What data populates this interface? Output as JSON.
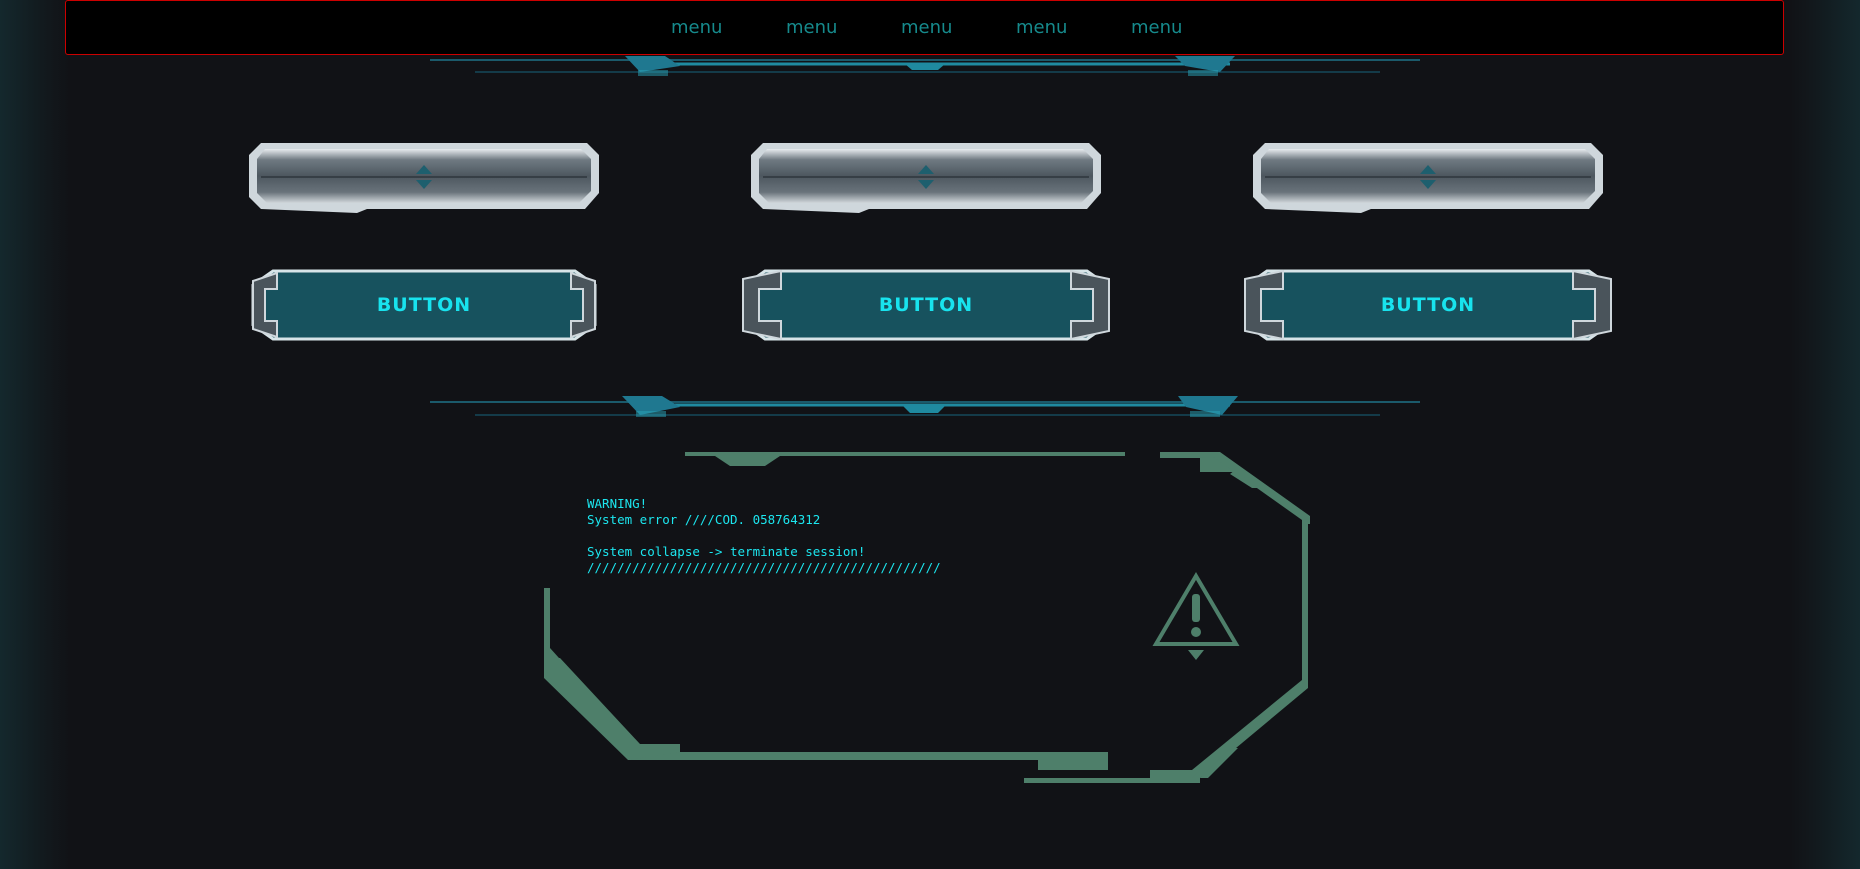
{
  "nav": {
    "items": [
      "menu",
      "menu",
      "menu",
      "menu",
      "menu"
    ]
  },
  "slots": [
    {
      "icon": "up-down-arrows-icon"
    },
    {
      "icon": "up-down-arrows-icon"
    },
    {
      "icon": "up-down-arrows-icon"
    }
  ],
  "buttons": [
    {
      "label": "BUTTON"
    },
    {
      "label": "BUTTON"
    },
    {
      "label": "BUTTON"
    }
  ],
  "warning": {
    "line1": "WARNING!",
    "line2": "System error ////COD. 058764312",
    "line3": "",
    "line4": "System collapse -> terminate session!",
    "line5": "///////////////////////////////////////////////",
    "icon": "warning-triangle-icon"
  },
  "colors": {
    "background": "#111216",
    "nav_border": "#cc0000",
    "nav_text": "#168a8c",
    "accent_cyan": "#18e3ee",
    "button_fill": "#17525e",
    "panel_green": "#4e7f6a"
  }
}
